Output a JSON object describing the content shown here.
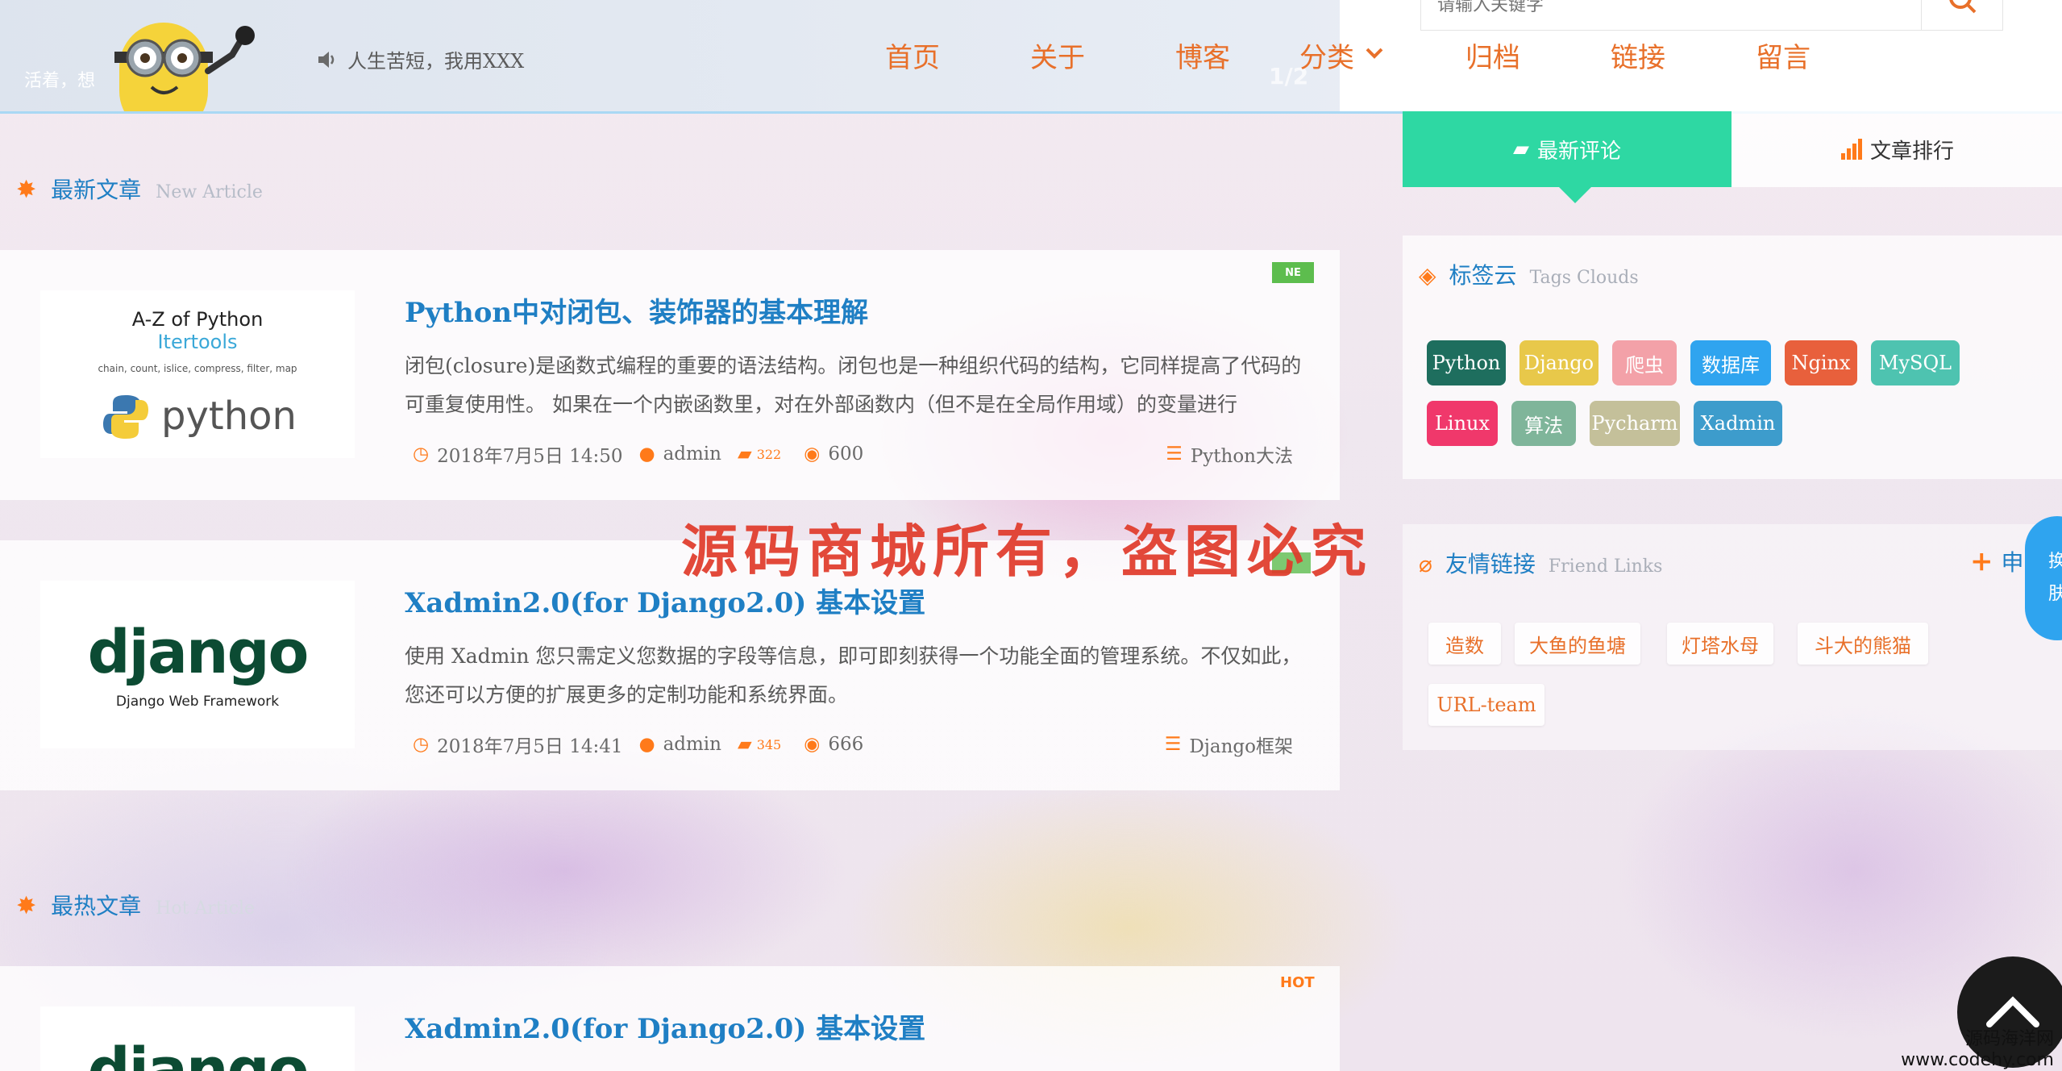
{
  "header": {
    "motto": "活着，想",
    "notice": "人生苦短，我用XXX",
    "nav": [
      "首页",
      "关于",
      "博客",
      "分类",
      "归档",
      "链接",
      "留言"
    ],
    "search_placeholder": "请输入关键字",
    "slide_indicator": "1/2"
  },
  "new_articles": {
    "title": "最新文章",
    "subtitle": "New Article",
    "items": [
      {
        "title": "Python中对闭包、装饰器的基本理解",
        "desc": "闭包(closure)是函数式编程的重要的语法结构。闭包也是一种组织代码的结构，它同样提高了代码的可重复使用性。 如果在一个内嵌函数里，对在外部函数内（但不是在全局作用域）的变量进行",
        "date": "2018年7月5日 14:50",
        "author": "admin",
        "comments": "322",
        "views": "600",
        "category": "Python大法",
        "badge": "NE",
        "thumb": {
          "line1": "A-Z of Python",
          "line2": "Itertools",
          "line3": "chain, count, islice, compress, filter, map",
          "logo": "python"
        }
      },
      {
        "title": "Xadmin2.0(for Django2.0) 基本设置",
        "desc": "使用 Xadmin 您只需定义您数据的字段等信息，即可即刻获得一个功能全面的管理系统。不仅如此，您还可以方便的扩展更多的定制功能和系统界面。",
        "date": "2018年7月5日 14:41",
        "author": "admin",
        "comments": "345",
        "views": "666",
        "category": "Django框架",
        "thumb": {
          "logo": "django",
          "sub": "Django Web Framework"
        }
      }
    ]
  },
  "hot_articles": {
    "title": "最热文章",
    "subtitle": "Hot Article",
    "items": [
      {
        "title": "Xadmin2.0(for Django2.0) 基本设置",
        "badge": "HOT",
        "thumb": {
          "logo": "django"
        }
      }
    ]
  },
  "sidebar": {
    "tabs": [
      "最新评论",
      "文章排行"
    ],
    "tags_title": "标签云",
    "tags_subtitle": "Tags Clouds",
    "tags": [
      {
        "label": "Python",
        "color": "#1e6e5e"
      },
      {
        "label": "Django",
        "color": "#e8c84a"
      },
      {
        "label": "爬虫",
        "color": "#f3a1a8"
      },
      {
        "label": "数据库",
        "color": "#2fa4ef"
      },
      {
        "label": "Nginx",
        "color": "#e8603c"
      },
      {
        "label": "MySQL",
        "color": "#4ec3b0"
      },
      {
        "label": "Linux",
        "color": "#f0386b"
      },
      {
        "label": "算法",
        "color": "#7fb59a"
      },
      {
        "label": "Pycharm",
        "color": "#c4c09a"
      },
      {
        "label": "Xadmin",
        "color": "#3d9ccc"
      }
    ],
    "links_title": "友情链接",
    "links_subtitle": "Friend Links",
    "links_apply": "申",
    "links": [
      "造数",
      "大鱼的鱼塘",
      "灯塔水母",
      "斗大的熊猫",
      "URL-team"
    ]
  },
  "overlay": {
    "watermark": "源码商城所有，盗图必究",
    "skin_button": [
      "换",
      "肤"
    ],
    "corner_line1": "源码海洋网",
    "corner_line2": "www.codehy.com"
  }
}
